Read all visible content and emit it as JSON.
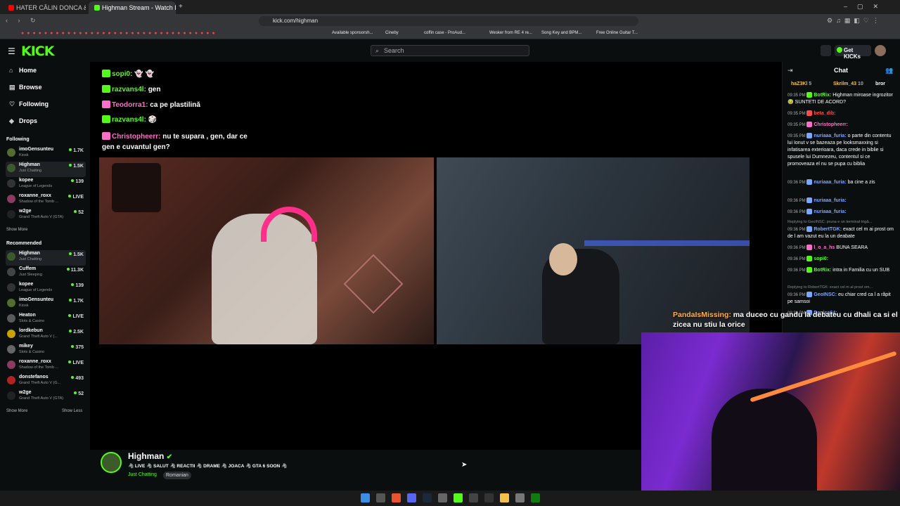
{
  "browser": {
    "tabs": [
      {
        "label": "HATER CĂLIN DONCA & LĂDIȚERII"
      },
      {
        "label": "Highman Stream - Watch Live"
      }
    ],
    "url": "kick.com/highman",
    "bookmarks": [
      "Available sponsorsh...",
      "Cineby",
      "coffin case - ProAud...",
      "Wesker from RE 4 re...",
      "Song Key and BPM...",
      "Free Online Guitar T..."
    ]
  },
  "kick": {
    "logo": "KICK",
    "search_placeholder": "Search",
    "get_kicks": "Get KICKs",
    "nav": [
      "Home",
      "Browse",
      "Following",
      "Drops"
    ],
    "following_title": "Following",
    "following": [
      {
        "name": "imoGensunteu",
        "cat": "Kiosk",
        "viewers": "1.7K",
        "color": "#556b2f"
      },
      {
        "name": "Highman",
        "cat": "Just Chatting",
        "viewers": "1.5K",
        "color": "#3c5a2a"
      },
      {
        "name": "kopee",
        "cat": "League of Legends",
        "viewers": "139",
        "color": "#333"
      },
      {
        "name": "roxanne_roxx",
        "cat": "Shadow of the Tomb ...",
        "viewers": "LIVE",
        "color": "#8b3a62"
      },
      {
        "name": "w2ge",
        "cat": "Grand Theft Auto V (GTA)",
        "viewers": "52",
        "color": "#222"
      }
    ],
    "show_more": "Show More",
    "recommended_title": "Recommended",
    "recommended": [
      {
        "name": "Highman",
        "cat": "Just Chatting",
        "viewers": "1.5K",
        "color": "#3c5a2a"
      },
      {
        "name": "Cuffem",
        "cat": "Just Sleeping",
        "viewers": "11.3K",
        "color": "#444"
      },
      {
        "name": "kopee",
        "cat": "League of Legends",
        "viewers": "139",
        "color": "#333"
      },
      {
        "name": "imoGensunteu",
        "cat": "Kiosk",
        "viewers": "1.7K",
        "color": "#556b2f"
      },
      {
        "name": "Heaton",
        "cat": "Slots & Casino",
        "viewers": "LIVE",
        "color": "#5a5a5a"
      },
      {
        "name": "lordkebun",
        "cat": "Grand Theft Auto V (...",
        "viewers": "2.5K",
        "color": "#c8a200"
      },
      {
        "name": "mikey",
        "cat": "Slots & Casino",
        "viewers": "375",
        "color": "#666"
      },
      {
        "name": "roxanne_roxx",
        "cat": "Shadow of the Tomb ...",
        "viewers": "LIVE",
        "color": "#8b3a62"
      },
      {
        "name": "donstefanos",
        "cat": "Grand Theft Auto V (G...",
        "viewers": "493",
        "color": "#b22222"
      },
      {
        "name": "w2ge",
        "cat": "Grand Theft Auto V (GTA)",
        "viewers": "52",
        "color": "#222"
      }
    ],
    "show_more2": "Show More",
    "show_less": "Show Less"
  },
  "stream_overlay_chat": [
    {
      "user": "sopi0:",
      "text": "👻 👻",
      "color": "#53fc18"
    },
    {
      "user": "razvans4l:",
      "text": "gen",
      "color": "#53fc18"
    },
    {
      "user": "Teodorra1:",
      "text": "ca pe plastilină",
      "color": "#ff6ec7"
    },
    {
      "user": "razvans4l:",
      "text": "🎲",
      "color": "#53fc18"
    },
    {
      "user": "Christopheerr:",
      "text": "nu te supara , gen, dar ce",
      "color": "#ff6ec7"
    },
    {
      "user": "",
      "text": "gen e cuvantul gen?",
      "color": "#fff"
    }
  ],
  "streamer": {
    "name": "Highman",
    "title": "🦓 LIVE 🦓 SALUT 🦓 REACTII 🦓 DRAME 🦓 JOACA 🦓 GTA 6 SOON 🦓",
    "category": "Just Chatting",
    "language": "Romanian"
  },
  "chat": {
    "title": "Chat",
    "gifters": [
      {
        "name": "haZ3Kl",
        "count": "5"
      },
      {
        "name": "Skrilm_43",
        "count": "10"
      },
      {
        "name": "bror",
        "count": ""
      }
    ],
    "messages": [
      {
        "time": "09:35 PM",
        "user": "BotRix:",
        "color": "#53fc18",
        "text": "Highman miroase ingrozitor 🤢 SUNTETI DE ACORD?"
      },
      {
        "time": "09:35 PM",
        "user": "beta_dib:",
        "color": "#ff4d4d",
        "text": ""
      },
      {
        "time": "09:35 PM",
        "user": "Christopheerr:",
        "color": "#ff6ec7",
        "text": ""
      },
      {
        "time": "09:35 PM",
        "user": "nuriaaa_furia:",
        "color": "#7aa7ff",
        "text": "o parte din contentu lui Ionut v se bazeaza pe looksmaxxing si infatisarea exterioara, daca crede in biblie si spusele lui Dumnezeu, contentul si ce promoveaza el nu se pupa cu biblia"
      },
      {
        "time": "09:36 PM",
        "user": "nuriaaa_furia:",
        "color": "#7aa7ff",
        "text": "ba cine a zis"
      },
      {
        "time": "09:36 PM",
        "user": "nuriaaa_furia:",
        "color": "#7aa7ff",
        "text": ""
      },
      {
        "time": "09:36 PM",
        "user": "nuriaaa_furia:",
        "color": "#7aa7ff",
        "text": ""
      }
    ],
    "reply1": "Replying to GeoINSC: pruna e un terminal trig&...",
    "messages2": [
      {
        "time": "09:36 PM",
        "user": "RobertTGK:",
        "color": "#7aa7ff",
        "text": "exact cel m ai prost om de l am vazut eu la un deabate"
      },
      {
        "time": "09:36 PM",
        "user": "l_o_a_hs",
        "color": "#ff6ec7",
        "text": "BUNA SEARA"
      },
      {
        "time": "09:36 PM",
        "user": "sopi0:",
        "color": "#53fc18",
        "text": ""
      },
      {
        "time": "09:36 PM",
        "user": "BotRix:",
        "color": "#53fc18",
        "text": "intra in Familia cu un SUB"
      }
    ],
    "reply2": "Replying to RobertTGK: exact cel m al prost om...",
    "messages3": [
      {
        "time": "09:36 PM",
        "user": "GeoINSC:",
        "color": "#7aa7ff",
        "text": "eu chiar cred ca l a răpit pe samsoi"
      },
      {
        "time": "09:36 PM",
        "user": "Denisa64:",
        "color": "#7aa7ff",
        "text": ""
      }
    ]
  },
  "overlay": {
    "user": "PandaIsMissing:",
    "text": "ma duceo cu gandu la debateu cu dhali ca si el zicea nu stiu la orice"
  }
}
